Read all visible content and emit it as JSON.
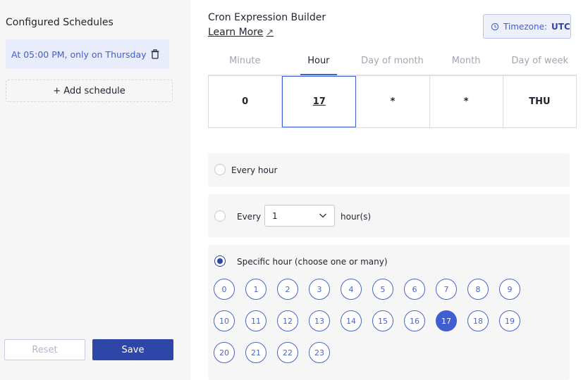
{
  "sidebar": {
    "title": "Configured Schedules",
    "schedule_item": "At 05:00 PM, only on Thursday",
    "add_schedule": "+ Add schedule",
    "reset_label": "Reset",
    "save_label": "Save"
  },
  "builder": {
    "title": "Cron Expression Builder",
    "learn_more": "Learn More",
    "external_icon": "↗",
    "timezone_label": "Timezone:",
    "timezone_value": "UTC"
  },
  "tabs": [
    "Minute",
    "Hour",
    "Day of month",
    "Month",
    "Day of week"
  ],
  "active_tab": 1,
  "fields": [
    "0",
    "17",
    "*",
    "*",
    "THU"
  ],
  "options": {
    "every_hour": "Every hour",
    "every_n_prefix": "Every",
    "every_n_value": "1",
    "every_n_suffix": "hour(s)",
    "specific": "Specific hour (choose one or many)"
  },
  "hours": [
    "0",
    "1",
    "2",
    "3",
    "4",
    "5",
    "6",
    "7",
    "8",
    "9",
    "10",
    "11",
    "12",
    "13",
    "14",
    "15",
    "16",
    "17",
    "18",
    "19",
    "20",
    "21",
    "22",
    "23"
  ],
  "selected_hour": "17",
  "colors": {
    "accent": "#3f5fd0",
    "primary_button": "#2d46a8",
    "sidebar_bg": "#f6f6f7"
  },
  "icons": {
    "trash": "trash-icon",
    "clock": "clock-history-icon",
    "chevron": "chevron-down-icon",
    "external": "external-link-icon"
  }
}
